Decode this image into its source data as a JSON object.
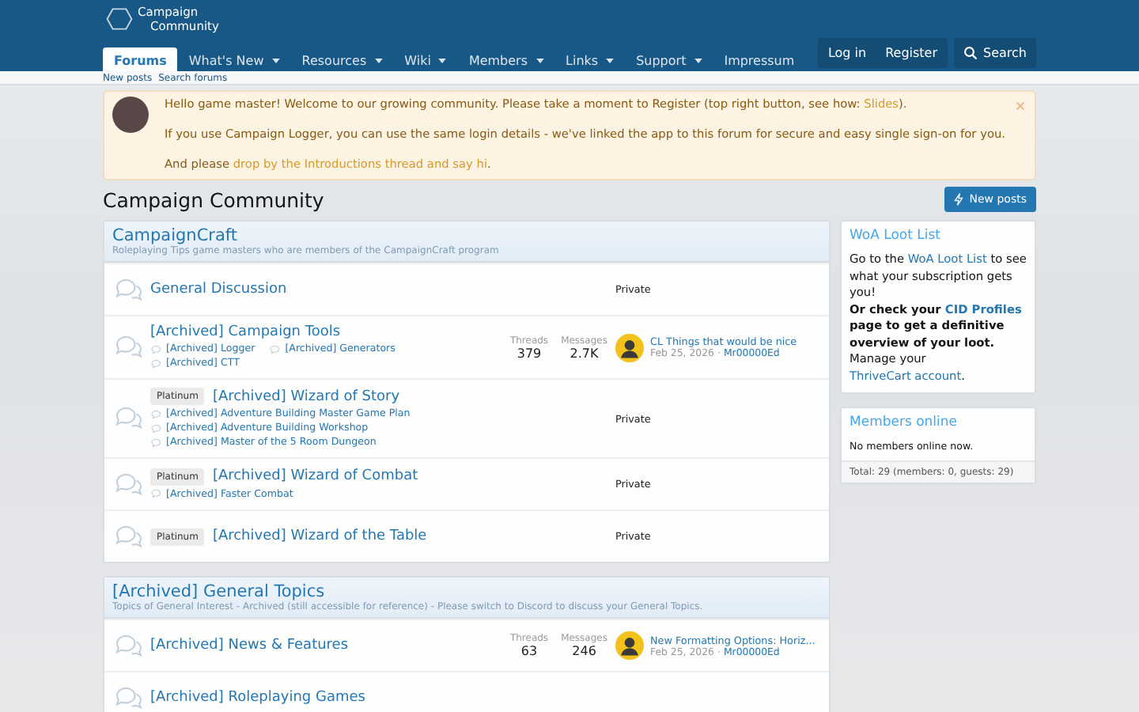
{
  "header": {
    "logo_lines": [
      "Campaign",
      "Community"
    ],
    "nav": [
      {
        "label": "Forums",
        "selected": true,
        "has_menu": false
      },
      {
        "label": "What's New",
        "selected": false,
        "has_menu": true
      },
      {
        "label": "Resources",
        "selected": false,
        "has_menu": true
      },
      {
        "label": "Wiki",
        "selected": false,
        "has_menu": true
      },
      {
        "label": "Members",
        "selected": false,
        "has_menu": true
      },
      {
        "label": "Links",
        "selected": false,
        "has_menu": true
      },
      {
        "label": "Support",
        "selected": false,
        "has_menu": true
      },
      {
        "label": "Impressum",
        "selected": false,
        "has_menu": false
      }
    ],
    "login": "Log in",
    "register": "Register",
    "search": "Search"
  },
  "subnav": [
    "New posts",
    "Search forums"
  ],
  "notice": {
    "paragraphs": [
      [
        {
          "text": "Hello game master! Welcome to our growing community. Please take a moment to Register (top right button, see how: "
        },
        {
          "link": "Slides"
        },
        {
          "text": ")."
        }
      ],
      [
        {
          "text": "If you use Campaign Logger, you can use the same login details - we've linked the app to this forum for secure and easy single sign-on for you."
        }
      ],
      [
        {
          "text": "And please "
        },
        {
          "link": "drop by the Introductions thread and say hi"
        },
        {
          "text": "."
        }
      ]
    ]
  },
  "page_title": "Campaign Community",
  "new_posts_button": "New posts",
  "categories": [
    {
      "title": "CampaignCraft",
      "description": "Roleplaying Tips game masters who are members of the CampaignCraft program",
      "nodes": [
        {
          "title": "General Discussion",
          "status": "Private"
        },
        {
          "title": "[Archived] Campaign Tools",
          "subforums": [
            "[Archived] Logger",
            "[Archived] Generators",
            "[Archived] CTT"
          ],
          "stats": {
            "threads_label": "Threads",
            "threads": "379",
            "messages_label": "Messages",
            "messages": "2.7K"
          },
          "latest": {
            "title": "CL Things that would be nice",
            "date": "Feb 25, 2026",
            "separator": "·",
            "user": "Mr00000Ed"
          }
        },
        {
          "title": "[Archived] Wizard of Story",
          "badge": "Platinum",
          "subforums": [
            "[Archived] Adventure Building Master Game Plan",
            "[Archived] Adventure Building Workshop",
            "[Archived] Master of the 5 Room Dungeon"
          ],
          "status": "Private"
        },
        {
          "title": "[Archived] Wizard of Combat",
          "badge": "Platinum",
          "subforums": [
            "[Archived] Faster Combat"
          ],
          "status": "Private"
        },
        {
          "title": "[Archived] Wizard of the Table",
          "badge": "Platinum",
          "status": "Private"
        }
      ]
    },
    {
      "title": "[Archived] General Topics",
      "description": "Topics of General Interest - Archived (still accessible for reference) - Please switch to Discord to discuss your General Topics.",
      "nodes": [
        {
          "title": "[Archived] News & Features",
          "stats": {
            "threads_label": "Threads",
            "threads": "63",
            "messages_label": "Messages",
            "messages": "246"
          },
          "latest": {
            "title": "New Formatting Options: Horiz...",
            "date": "Feb 25, 2026",
            "separator": "·",
            "user": "Mr00000Ed"
          }
        },
        {
          "title": "[Archived] Roleplaying Games"
        }
      ]
    }
  ],
  "sidebar": [
    {
      "kind": "rich",
      "title": "WoA Loot List",
      "paragraphs": [
        {
          "bold": false,
          "segments": [
            {
              "text": "Go to the "
            },
            {
              "link": "WoA Loot List"
            },
            {
              "text": " to see what your subscription gets you!"
            }
          ]
        },
        {
          "bold": true,
          "segments": [
            {
              "text": "Or check your "
            },
            {
              "link": "CID Profiles"
            },
            {
              "text": " page to get a definitive overview of your loot."
            }
          ]
        },
        {
          "bold": false,
          "segments": [
            {
              "text": "Manage your "
            },
            {
              "link": "ThriveCart account"
            },
            {
              "text": "."
            }
          ]
        }
      ]
    },
    {
      "kind": "members",
      "title": "Members online",
      "body": "No members online now.",
      "footer": "Total: 29 (members: 0, guests: 29)"
    }
  ]
}
